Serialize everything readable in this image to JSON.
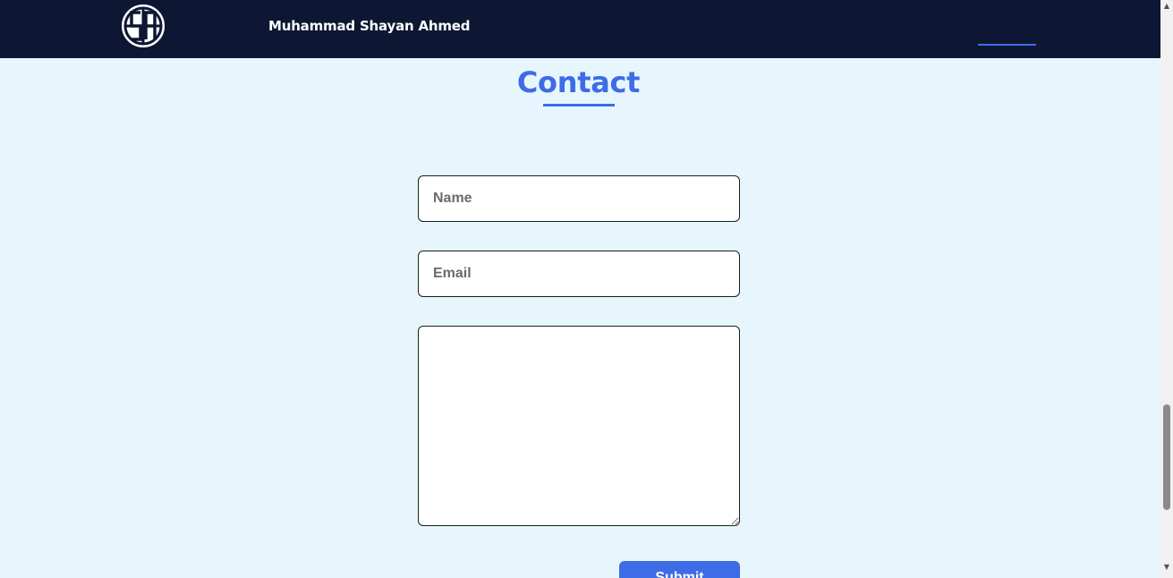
{
  "header": {
    "brand_name": "Muhammad Shayan Ahmed",
    "logo_icon": "sa-monogram-logo-icon",
    "active_indicator_color": "#3b6fe8"
  },
  "contact": {
    "title": "Contact",
    "name_placeholder": "Name",
    "email_placeholder": "Email",
    "message_value": "",
    "submit_label": "Submit"
  },
  "colors": {
    "navbar_bg": "#0d1733",
    "page_bg": "#e6f6fc",
    "accent": "#3e6be6"
  },
  "scrollbar": {
    "up_glyph": "▲",
    "down_glyph": "▼"
  }
}
